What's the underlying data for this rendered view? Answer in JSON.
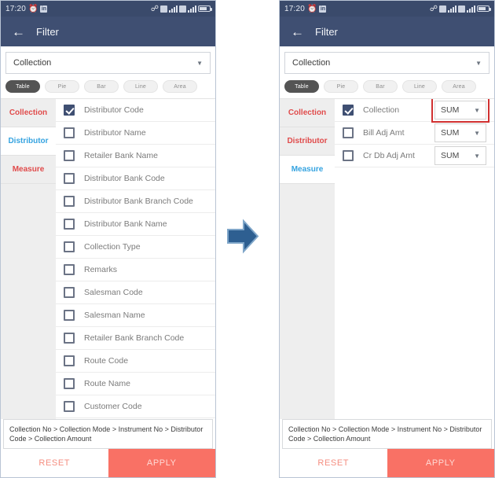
{
  "status_bar": {
    "time": "17:20",
    "icons_left": [
      "alarm-icon",
      "linkedin-icon"
    ],
    "icons_right": [
      "bluetooth-icon",
      "sim-icon",
      "signal-bars-icon",
      "sim2-icon",
      "wifi-icon",
      "battery-icon"
    ]
  },
  "app_bar": {
    "back_icon": "back-arrow-icon",
    "title": "Filter"
  },
  "dropdown": {
    "value": "Collection",
    "caret_icon": "chevron-down-icon"
  },
  "chart_tabs": [
    {
      "label": "Table",
      "active": true
    },
    {
      "label": "Pie",
      "active": false
    },
    {
      "label": "Bar",
      "active": false
    },
    {
      "label": "Line",
      "active": false
    },
    {
      "label": "Area",
      "active": false
    }
  ],
  "left_panel": {
    "sidenav": [
      {
        "label": "Collection",
        "active": false
      },
      {
        "label": "Distributor",
        "active": true
      },
      {
        "label": "Measure",
        "active": false
      }
    ],
    "rows": [
      {
        "label": "Distributor Code",
        "checked": true
      },
      {
        "label": "Distributor Name",
        "checked": false
      },
      {
        "label": "Retailer Bank Name",
        "checked": false
      },
      {
        "label": "Distributor Bank Code",
        "checked": false
      },
      {
        "label": "Distributor Bank Branch Code",
        "checked": false
      },
      {
        "label": "Distributor Bank Name",
        "checked": false
      },
      {
        "label": "Collection Type",
        "checked": false
      },
      {
        "label": "Remarks",
        "checked": false
      },
      {
        "label": "Salesman Code",
        "checked": false
      },
      {
        "label": "Salesman Name",
        "checked": false
      },
      {
        "label": "Retailer Bank Branch Code",
        "checked": false
      },
      {
        "label": "Route Code",
        "checked": false
      },
      {
        "label": "Route Name",
        "checked": false
      },
      {
        "label": "Customer Code",
        "checked": false
      }
    ]
  },
  "right_panel": {
    "sidenav": [
      {
        "label": "Collection",
        "active": false
      },
      {
        "label": "Distributor",
        "active": false
      },
      {
        "label": "Measure",
        "active": true
      }
    ],
    "rows": [
      {
        "label": "Collection",
        "checked": true,
        "aggregate": "SUM",
        "highlighted": true
      },
      {
        "label": "Bill Adj Amt",
        "checked": false,
        "aggregate": "SUM",
        "highlighted": false
      },
      {
        "label": "Cr Db Adj Amt",
        "checked": false,
        "aggregate": "SUM",
        "highlighted": false
      }
    ]
  },
  "breadcrumb": "Collection No > Collection Mode > Instrument No > Distributor Code > Collection Amount",
  "footer": {
    "reset_label": "RESET",
    "apply_label": "APPLY"
  },
  "arrow": {
    "icon": "right-arrow-icon"
  },
  "colors": {
    "appbar": "#3f4f72",
    "statusbar": "#3a4a6b",
    "active_nav": "#35a3e0",
    "nav_text": "#e04b4b",
    "apply": "#f97165",
    "reset_text": "#f58e80",
    "highlight": "#d13030",
    "arrow": "#2e5f91",
    "checkbox_checked": "#3f4f72"
  }
}
